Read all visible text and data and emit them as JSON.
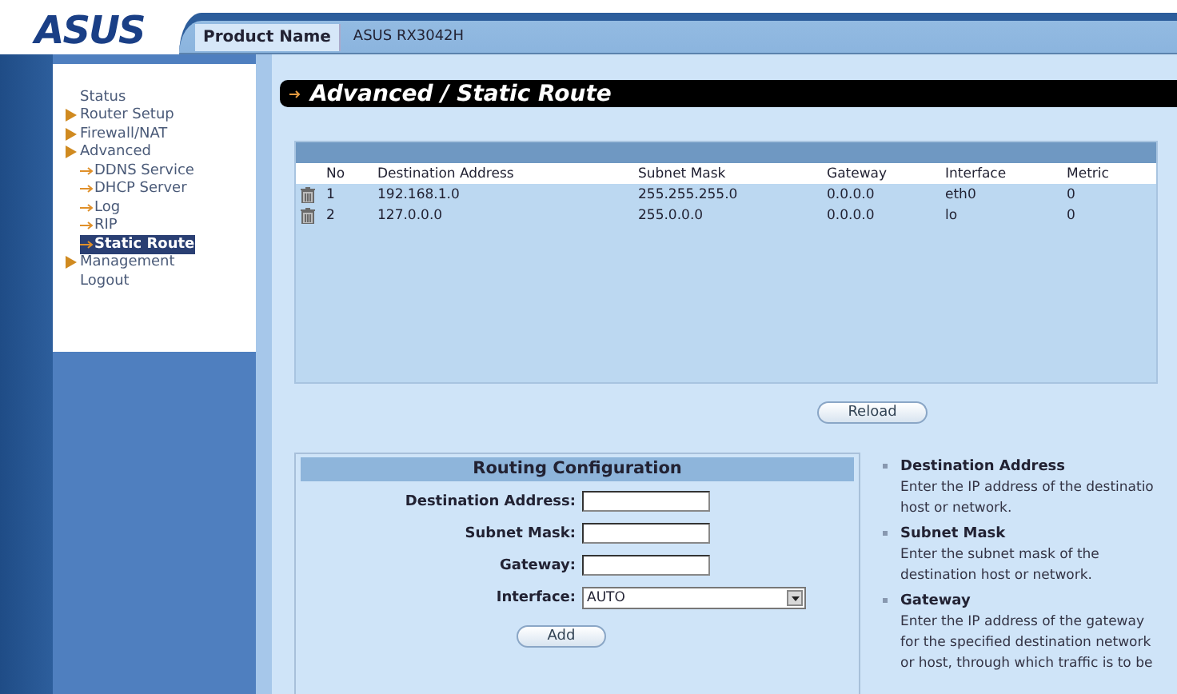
{
  "header": {
    "logo": "ASUS",
    "product_label": "Product Name",
    "product_value": "ASUS RX3042H"
  },
  "sidebar": {
    "items": [
      {
        "label": "Status",
        "kind": "plain",
        "selected": false
      },
      {
        "label": "Router Setup",
        "kind": "section",
        "selected": false
      },
      {
        "label": "Firewall/NAT",
        "kind": "section",
        "selected": false
      },
      {
        "label": "Advanced",
        "kind": "section",
        "selected": false,
        "children": [
          {
            "label": "DDNS Service",
            "kind": "sub",
            "selected": false
          },
          {
            "label": "DHCP Server",
            "kind": "sub",
            "selected": false
          },
          {
            "label": "Log",
            "kind": "sub",
            "selected": false
          },
          {
            "label": "RIP",
            "kind": "sub",
            "selected": false
          },
          {
            "label": "Static Route",
            "kind": "sub",
            "selected": true
          }
        ]
      },
      {
        "label": "Management",
        "kind": "section",
        "selected": false
      },
      {
        "label": "Logout",
        "kind": "plain",
        "selected": false
      }
    ]
  },
  "page_title": "Advanced / Static Route",
  "table": {
    "columns": [
      "No",
      "Destination Address",
      "Subnet Mask",
      "Gateway",
      "Interface",
      "Metric"
    ],
    "rows": [
      [
        "1",
        "192.168.1.0",
        "255.255.255.0",
        "0.0.0.0",
        "eth0",
        "0"
      ],
      [
        "2",
        "127.0.0.0",
        "255.0.0.0",
        "0.0.0.0",
        "lo",
        "0"
      ]
    ]
  },
  "reload_button": "Reload",
  "routing_config": {
    "title": "Routing Configuration",
    "fields": [
      {
        "label": "Destination Address:",
        "kind": "text"
      },
      {
        "label": "Subnet Mask:",
        "kind": "text"
      },
      {
        "label": "Gateway:",
        "kind": "text"
      },
      {
        "label": "Interface:",
        "kind": "select",
        "value": "AUTO"
      }
    ],
    "add_button": "Add"
  },
  "help": [
    {
      "title": "Destination Address",
      "lines": [
        "Enter the IP address of the destinatio",
        "host or network."
      ]
    },
    {
      "title": "Subnet Mask",
      "lines": [
        "Enter the subnet mask of the",
        "destination host or network."
      ]
    },
    {
      "title": "Gateway",
      "lines": [
        "Enter the IP address of the gateway",
        "for the specified destination network",
        "or host, through which traffic is to be"
      ]
    }
  ]
}
